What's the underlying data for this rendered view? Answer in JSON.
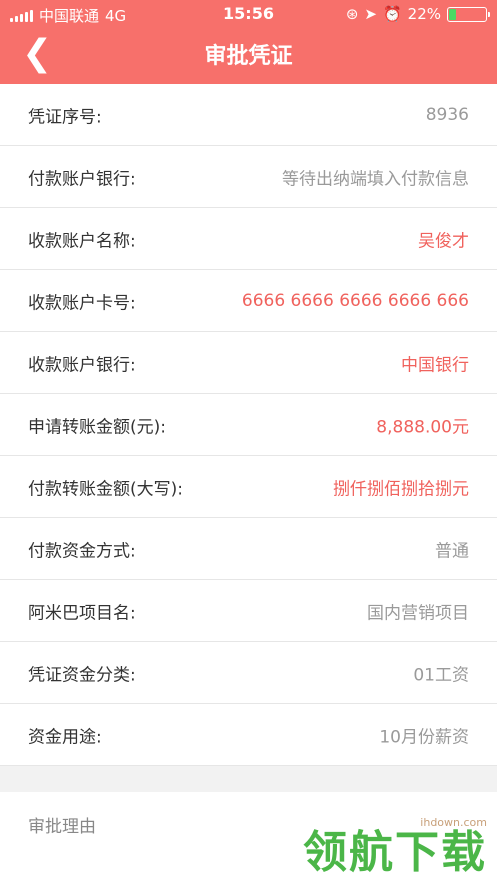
{
  "status": {
    "carrier": "中国联通",
    "network": "4G",
    "time": "15:56",
    "battery_pct": "22%",
    "battery_level": 0.22
  },
  "header": {
    "title": "审批凭证",
    "back_icon": "chevron-left-icon"
  },
  "fields": [
    {
      "label": "凭证序号:",
      "value": "8936"
    },
    {
      "label": "付款账户银行:",
      "value": "等待出纳端填入付款信息"
    },
    {
      "label": "收款账户名称:",
      "value": "吴俊才"
    },
    {
      "label": "收款账户卡号:",
      "value": "6666 6666 6666 6666 666"
    },
    {
      "label": "收款账户银行:",
      "value": "中国银行"
    },
    {
      "label": "申请转账金额(元):",
      "value": "8,888.00元"
    },
    {
      "label": "付款转账金额(大写):",
      "value": "捌仟捌佰捌拾捌元"
    },
    {
      "label": "付款资金方式:",
      "value": "普通"
    },
    {
      "label": "阿米巴项目名:",
      "value": "国内营销项目"
    },
    {
      "label": "凭证资金分类:",
      "value": "01工资"
    },
    {
      "label": "资金用途:",
      "value": "10月份薪资"
    }
  ],
  "reason": {
    "label": "审批理由"
  },
  "watermark": {
    "site": "ihdown.com",
    "text": "领航下载"
  },
  "colors": {
    "accent": "#f7706b",
    "highlight": "#f0625d",
    "muted": "#9a9a9a"
  }
}
